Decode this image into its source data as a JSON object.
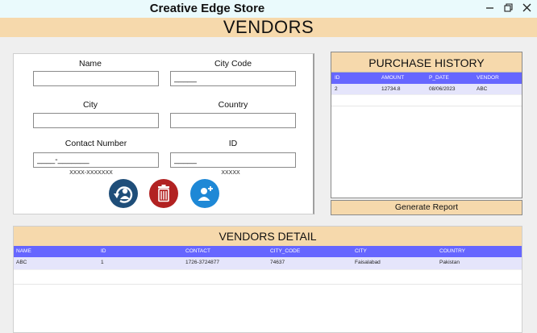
{
  "window": {
    "title": "Creative Edge Store",
    "controls": {
      "minimize_icon": "minimize-icon",
      "maximize_icon": "restore-icon",
      "close_icon": "close-icon"
    }
  },
  "page": {
    "heading": "VENDORS"
  },
  "form": {
    "name_label": "Name",
    "name_value": "",
    "city_code_label": "City Code",
    "city_code_value": "_____",
    "city_label": "City",
    "city_value": "",
    "country_label": "Country",
    "country_value": "",
    "contact_label": "Contact Number",
    "contact_value": "____-_______",
    "contact_hint": "XXXX-XXXXXXX",
    "id_label": "ID",
    "id_value": "_____",
    "id_hint": "XXXXX",
    "buttons": [
      {
        "name": "update",
        "icon": "refresh-user-icon",
        "color": "#1f4e79"
      },
      {
        "name": "delete",
        "icon": "trash-icon",
        "color": "#b22222"
      },
      {
        "name": "add",
        "icon": "add-user-icon",
        "color": "#1e88d6"
      }
    ]
  },
  "purchase_history": {
    "title": "PURCHASE HISTORY",
    "columns": [
      "ID",
      "AMOUNT",
      "P_DATE",
      "VENDOR"
    ],
    "rows": [
      [
        "2",
        "12734.8",
        "08/06/2023",
        "ABC"
      ]
    ],
    "header_color": "#6666ff",
    "row_color": "#e5e5fb"
  },
  "generate_report": {
    "label": "Generate Report"
  },
  "vendors_detail": {
    "title": "VENDORS DETAIL",
    "columns": [
      "NAME",
      "ID",
      "CONTACT",
      "CITY_CODE",
      "CITY",
      "COUNTRY"
    ],
    "rows": [
      [
        "ABC",
        "1",
        "1726-3724877",
        "74637",
        "Faisalabad",
        "Pakistan"
      ]
    ]
  },
  "colors": {
    "accent_header": "#f6d9ac",
    "table_header": "#6666ff",
    "titlebar": "#eafafc"
  }
}
